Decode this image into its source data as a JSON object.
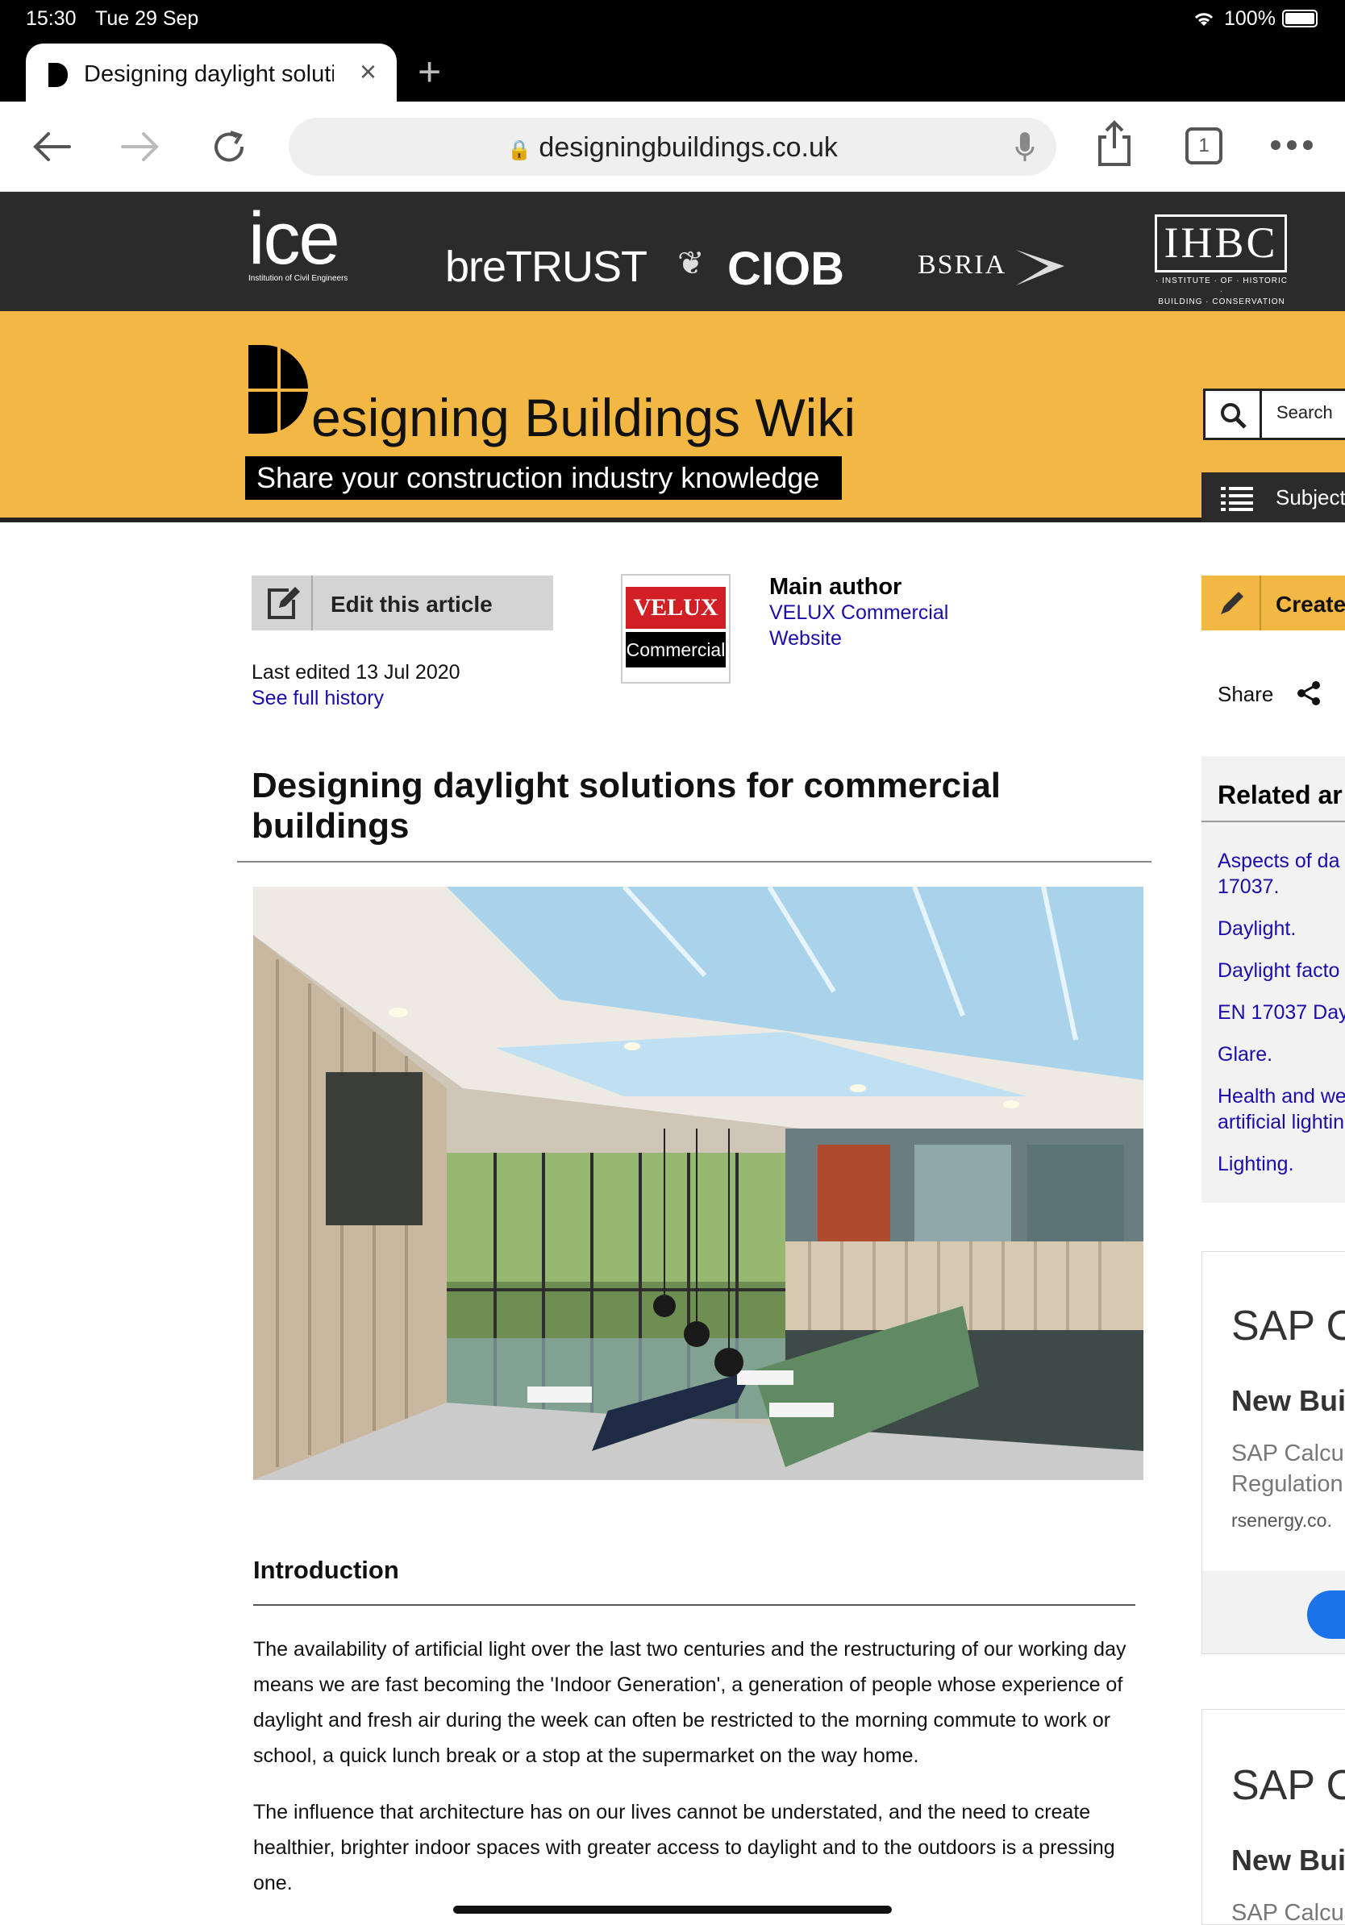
{
  "status": {
    "time": "15:30",
    "date": "Tue 29 Sep",
    "battery": "100%"
  },
  "tab": {
    "title": "Designing daylight soluti",
    "close": "×",
    "new_tab": "+"
  },
  "urlbar": {
    "url": "designingbuildings.co.uk",
    "tabs_count": "1"
  },
  "orgs": {
    "ice": "ice",
    "ice_sub": "Institution of Civil Engineers",
    "bre": "breTRUST",
    "ciob": "CIOB",
    "bsria": "BSRIA",
    "ihbc": "IHBC",
    "ihbc_sub1": "· INSTITUTE · OF · HISTORIC ·",
    "ihbc_sub2": "BUILDING · CONSERVATION"
  },
  "header": {
    "title": "esigning Buildings Wiki",
    "tagline": "Share your construction industry knowledge",
    "search_label": "Search",
    "subjects_label": "Subject"
  },
  "article": {
    "edit_label": "Edit this article",
    "last_edited": "Last edited 13 Jul 2020",
    "see_history": "See full history",
    "velux": "VELUX",
    "velux_sub": "Commercial",
    "main_author_label": "Main author",
    "author_name": "VELUX Commercial",
    "author_website": "Website",
    "title_line1": "Designing daylight solutions for commercial",
    "title_line2": "buildings",
    "intro_heading": "Introduction",
    "para1": "The availability of artificial light over the last two centuries and the restructuring of our working day means we are fast becoming the 'Indoor Generation', a generation of people whose experience of daylight and fresh air during the week can often be restricted to the morning commute to work or school, a quick lunch break or a stop at the supermarket on the way home.",
    "para2": "The influence that architecture has on our lives cannot be understated, and the need to create healthier, brighter indoor spaces with greater access to daylight and to the outdoors is a pressing one."
  },
  "sidebar": {
    "create_label": "Create",
    "share_label": "Share",
    "related_heading": "Related ar",
    "related": [
      "Aspects of da",
      "17037.",
      "Daylight.",
      "Daylight facto",
      "EN 17037 Day",
      "Glare.",
      "Health and we",
      "artificial lightin",
      "Lighting."
    ],
    "ad1": {
      "title": "SAP C",
      "subtitle": "New Buil",
      "text1": "SAP Calcu",
      "text2": "Regulation",
      "domain": "rsenergy.co."
    },
    "ad2": {
      "title": "SAP C",
      "subtitle": "New Buil",
      "text1": "SAP Calcu"
    }
  },
  "colors": {
    "accent": "#f2b843",
    "link": "#1a0dab",
    "dark": "#2b2b2b"
  }
}
